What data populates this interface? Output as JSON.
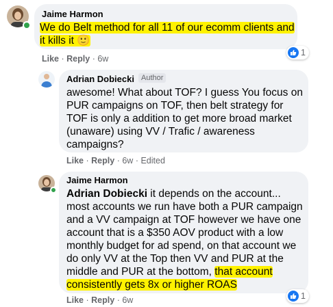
{
  "comments": [
    {
      "author": "Jaime Harmon",
      "lines": [
        "We do Belt method for all 11 of our ecomm clients and",
        "it kills it 🙂"
      ],
      "reaction_count": "1",
      "actions": {
        "like": "Like",
        "reply": "Reply",
        "time": "6w"
      }
    },
    {
      "author": "Adrian Dobiecki",
      "badge": "Author",
      "lines": [
        "awesome! What about TOF? I guess You focus on",
        "PUR campaigns on TOF, then belt strategy for",
        "TOF is only a addition to get more broad market",
        "(unaware) using VV / Trafic / awareness",
        "campaigns?"
      ],
      "actions": {
        "like": "Like",
        "reply": "Reply",
        "time": "6w",
        "edited": "Edited"
      }
    },
    {
      "author": "Jaime Harmon",
      "mention": "Adrian Dobiecki",
      "line1_rest": " it depends on the account...",
      "lines": [
        "most accounts we run have both a PUR campaign",
        "and a VV campaign at TOF however we have one",
        "account that is a $350 AOV product with a low",
        "monthly budget for ad spend, on that account we",
        "do only VV at the Top then VV and PUR at the"
      ],
      "line7_plain": "middle and PUR at the bottom, ",
      "line7_hl": "that account",
      "line8_hl": "consistently gets 8x or higher ROAS",
      "reaction_count": "1",
      "actions": {
        "like": "Like",
        "reply": "Reply",
        "time": "6w"
      }
    }
  ],
  "dot": "·",
  "colors": {
    "highlight": "#fff200",
    "like_blue": "#1877f2",
    "bubble": "#f0f2f5",
    "online": "#31a24c"
  },
  "icons": [
    "avatar-jaime",
    "avatar-adrian",
    "like-icon"
  ]
}
